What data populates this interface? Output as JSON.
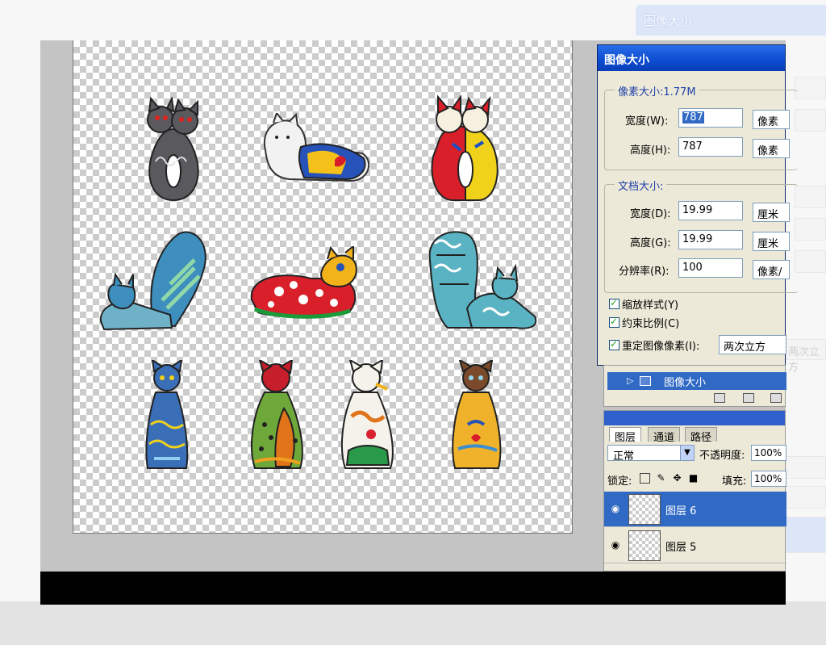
{
  "dialog": {
    "title": "图像大小",
    "pixel_dimensions": {
      "title": "像素大小:1.77M",
      "width_label": "宽度(W):",
      "width_value": "787",
      "width_unit": "像素",
      "height_label": "高度(H):",
      "height_value": "787",
      "height_unit": "像素"
    },
    "document_size": {
      "title": "文档大小:",
      "width_label": "宽度(D):",
      "width_value": "19.99",
      "width_unit": "厘米",
      "height_label": "高度(G):",
      "height_value": "19.99",
      "height_unit": "厘米",
      "resolution_label": "分辨率(R):",
      "resolution_value": "100",
      "resolution_unit": "像素/"
    },
    "checkboxes": {
      "scale_styles": "缩放样式(Y)",
      "constrain_proportions": "约束比例(C)",
      "resample": "重定图像像素(I):"
    },
    "resample_method": "两次立方"
  },
  "history": {
    "item": "图像大小"
  },
  "layers": {
    "tabs": [
      "图层",
      "通道",
      "路径"
    ],
    "blend_mode": "正常",
    "opacity_label": "不透明度:",
    "opacity_value": "100%",
    "lock_label": "锁定:",
    "fill_label": "填充:",
    "fill_value": "100%",
    "rows": [
      {
        "name": "图层 6",
        "active": true
      },
      {
        "name": "图层 5",
        "active": false
      }
    ]
  },
  "background": {
    "ghost_title": "图像大小",
    "ghost_resample": "两次立方"
  },
  "colors": {
    "title_blue": "#0b4bd0",
    "selection_blue": "#316ac5",
    "dialog_bg": "#ece9d8"
  }
}
